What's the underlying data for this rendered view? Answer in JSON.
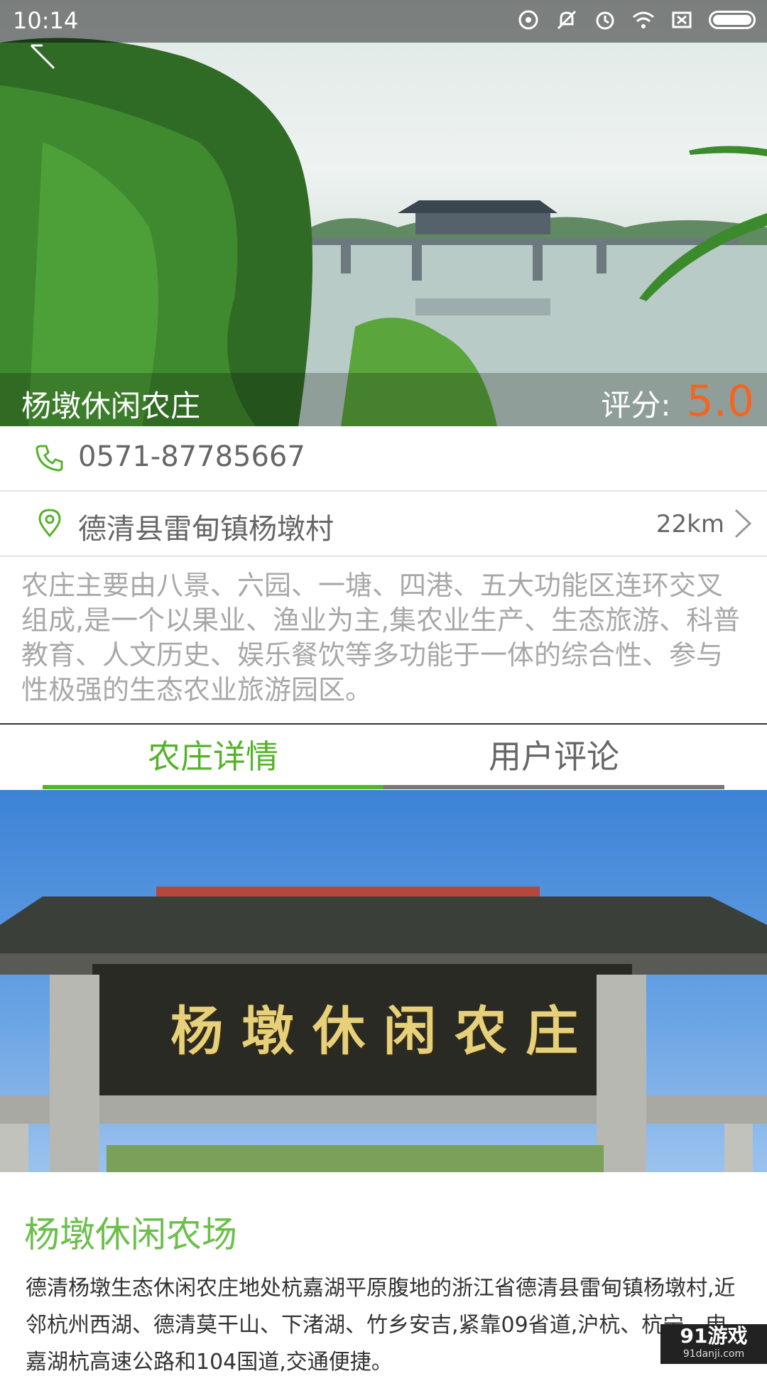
{
  "status_bar": {
    "time": "10:14"
  },
  "hero": {
    "farm_name": "杨墩休闲农庄",
    "rating_label": "评分:",
    "rating_value": "5.0"
  },
  "contact": {
    "phone": "0571-87785667"
  },
  "location": {
    "address": "德清县雷甸镇杨墩村",
    "distance": "22km"
  },
  "description": "农庄主要由八景、六园、一塘、四港、五大功能区连环交叉组成,是一个以果业、渔业为主,集农业生产、生态旅游、科普教育、人文历史、娱乐餐饮等多功能于一体的综合性、参与性极强的生态农业旅游园区。",
  "tabs": [
    {
      "label": "农庄详情",
      "active": true
    },
    {
      "label": "用户评论",
      "active": false
    }
  ],
  "gate_image": {
    "sign_text": "杨墩休闲农庄"
  },
  "article": {
    "title": "杨墩休闲农场",
    "body": "德清杨墩生态休闲农庄地处杭嘉湖平原腹地的浙江省德清县雷甸镇杨墩村,近邻杭州西湖、德清莫干山、下渚湖、竹乡安吉,紧靠09省道,沪杭、杭宁、申嘉湖杭高速公路和104国道,交通便捷。"
  },
  "watermark": {
    "main": "91游戏",
    "sub": "91danji.com"
  },
  "colors": {
    "accent_green": "#55b32a",
    "rating_orange": "#f26522",
    "tab_inactive_line": "#777777"
  },
  "icons": [
    "back-icon",
    "phone-icon",
    "location-pin-icon",
    "chevron-right-icon",
    "wifi-icon",
    "alarm-icon",
    "battery-icon"
  ]
}
